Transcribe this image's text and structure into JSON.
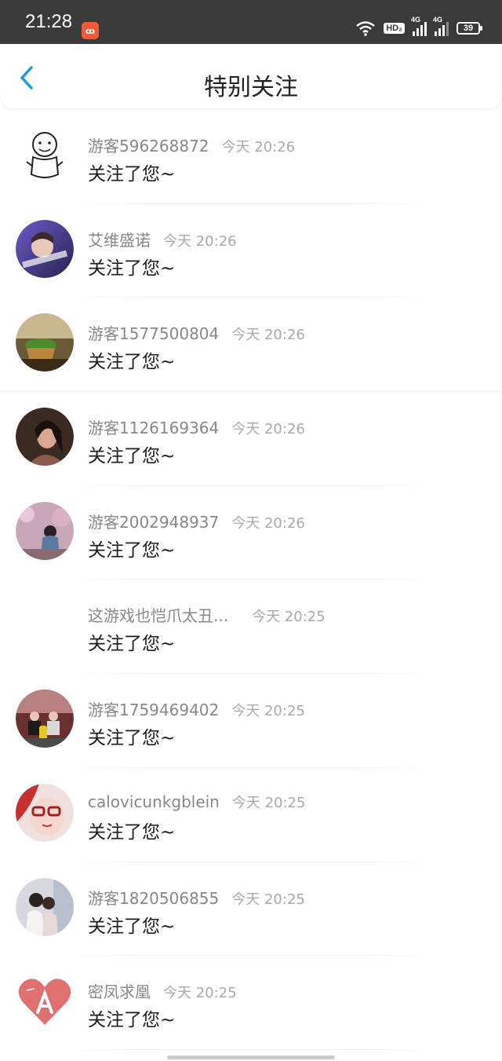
{
  "status_bar": {
    "time": "21:28",
    "app_badge": "ꝏ",
    "hd": "HD₂",
    "signal1": "4G",
    "signal2": "4G",
    "battery": "39"
  },
  "header": {
    "title": "特别关注",
    "back_icon": "chevron-left-icon"
  },
  "colors": {
    "accent": "#1a9be6",
    "status_bg": "#3a3a3a"
  },
  "list": [
    {
      "username": "游客596268872",
      "time": "今天 20:26",
      "message": "关注了您~"
    },
    {
      "username": "艾维盛诺",
      "time": "今天 20:26",
      "message": "关注了您~"
    },
    {
      "username": "游客1577500804",
      "time": "今天 20:26",
      "message": "关注了您~"
    },
    {
      "username": "游客1126169364",
      "time": "今天 20:26",
      "message": "关注了您~"
    },
    {
      "username": "游客2002948937",
      "time": "今天 20:26",
      "message": "关注了您~"
    },
    {
      "username": "这游戏也恺爪太丑...",
      "time": "今天 20:25",
      "message": "关注了您~"
    },
    {
      "username": "游客1759469402",
      "time": "今天 20:25",
      "message": "关注了您~"
    },
    {
      "username": "calovicunkgblein",
      "time": "今天 20:25",
      "message": "关注了您~"
    },
    {
      "username": "游客1820506855",
      "time": "今天 20:25",
      "message": "关注了您~"
    },
    {
      "username": "密凤求凰",
      "time": "今天 20:25",
      "message": "关注了您~"
    }
  ]
}
